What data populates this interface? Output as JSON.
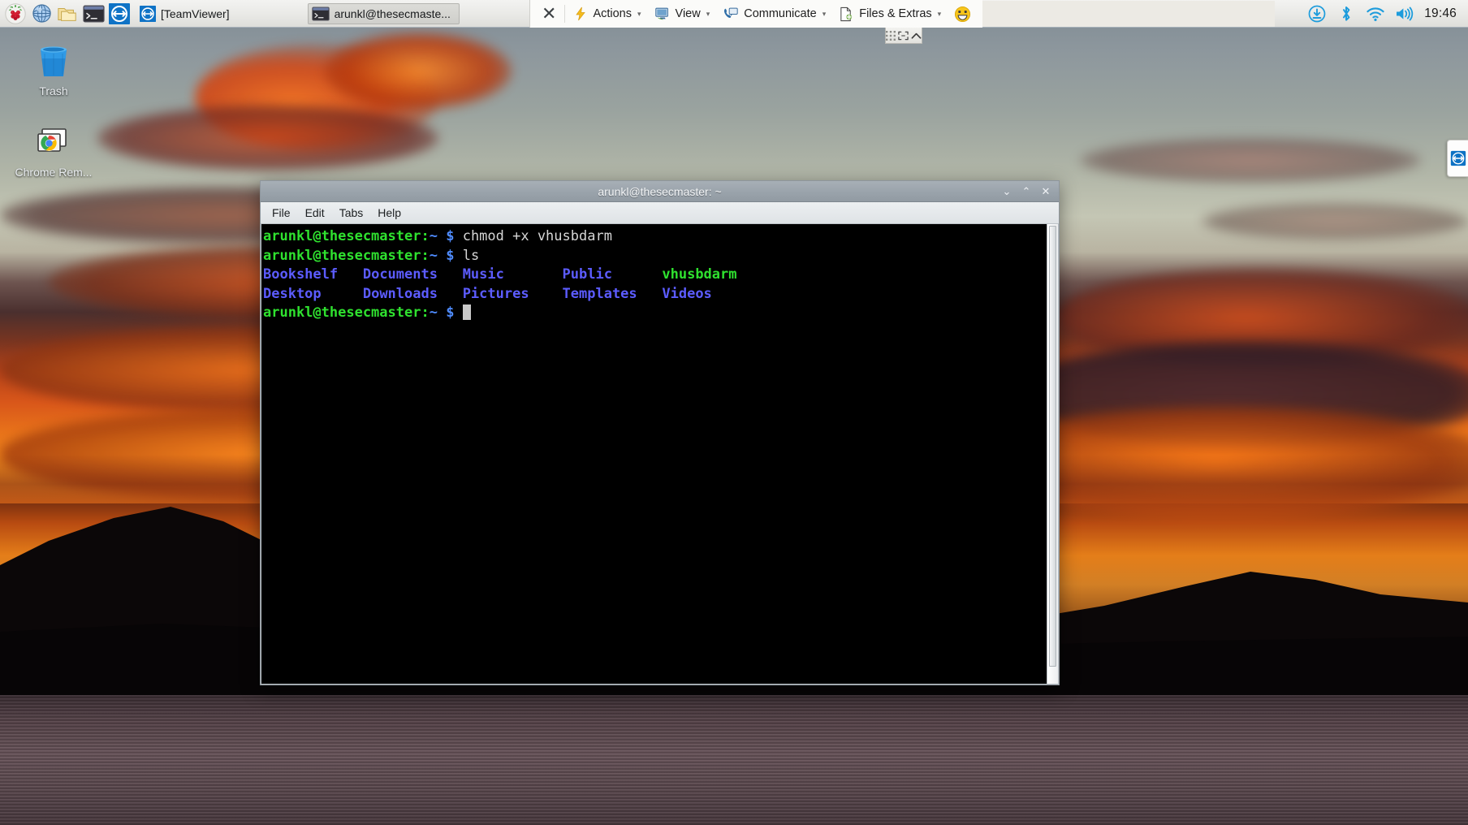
{
  "panel": {
    "launchers": [
      {
        "name": "raspberry-menu",
        "icon": "raspberry-icon",
        "label": "Menu"
      },
      {
        "name": "web-browser",
        "icon": "globe-icon",
        "label": "Web Browser"
      },
      {
        "name": "file-manager",
        "icon": "folder-icon",
        "label": "File Manager"
      },
      {
        "name": "terminal",
        "icon": "terminal-icon",
        "label": "Terminal"
      },
      {
        "name": "teamviewer",
        "icon": "teamviewer-icon",
        "label": "TeamViewer"
      }
    ],
    "windows": [
      {
        "title": "[TeamViewer]",
        "icon": "teamviewer-icon",
        "active": false
      },
      {
        "title": "arunkl@thesecmaste...",
        "icon": "terminal-icon",
        "active": true
      }
    ],
    "teamviewer_toolbar": {
      "close_label": "✕",
      "items": [
        {
          "label": "Actions",
          "icon": "lightning-icon",
          "caret": "▾"
        },
        {
          "label": "View",
          "icon": "monitor-icon",
          "caret": "▾"
        },
        {
          "label": "Communicate",
          "icon": "phone-icon",
          "caret": "▾"
        },
        {
          "label": "Files & Extras",
          "icon": "file-plus-icon",
          "caret": "▾"
        }
      ],
      "smiley": "ὠ0",
      "mini_controls": [
        {
          "name": "drag-grid-handle",
          "icon": "grid-handle-icon"
        },
        {
          "name": "fullscreen-toggle",
          "icon": "expand-icon"
        },
        {
          "name": "collapse-toolbar",
          "icon": "chevron-up-icon"
        }
      ]
    },
    "tray": [
      {
        "name": "updates",
        "icon": "download-arrow-icon"
      },
      {
        "name": "bluetooth",
        "icon": "bluetooth-icon"
      },
      {
        "name": "wifi",
        "icon": "wifi-icon"
      },
      {
        "name": "volume",
        "icon": "speaker-icon"
      }
    ],
    "clock": "19:46"
  },
  "desktop": {
    "icons": [
      {
        "name": "trash",
        "label": "Trash",
        "icon": "trash-icon"
      },
      {
        "name": "chrome-remote-desktop",
        "label": "Chrome Rem...",
        "icon": "chrome-remote-icon"
      }
    ],
    "teamviewer_edge_tab": {
      "name": "teamviewer-edge-tab",
      "icon": "teamviewer-icon"
    }
  },
  "terminal": {
    "title": "arunkl@thesecmaster: ~",
    "window_controls": {
      "minimize": "⌄",
      "maximize": "⌃",
      "close": "✕"
    },
    "menu": [
      "File",
      "Edit",
      "Tabs",
      "Help"
    ],
    "prompt": {
      "user_host": "arunkl@thesecmaster",
      "separator": ":",
      "path": "~",
      "sigil": "$"
    },
    "lines": [
      {
        "type": "prompt",
        "command": "chmod +x vhusbdarm"
      },
      {
        "type": "prompt",
        "command": "ls"
      },
      {
        "type": "ls",
        "cells": [
          {
            "text": "Bookshelf",
            "kind": "dir"
          },
          {
            "text": "Documents",
            "kind": "dir"
          },
          {
            "text": "Music",
            "kind": "dir"
          },
          {
            "text": "Public",
            "kind": "dir"
          },
          {
            "text": "vhusbdarm",
            "kind": "exec"
          }
        ]
      },
      {
        "type": "ls",
        "cells": [
          {
            "text": "Desktop",
            "kind": "dir"
          },
          {
            "text": "Downloads",
            "kind": "dir"
          },
          {
            "text": "Pictures",
            "kind": "dir"
          },
          {
            "text": "Templates",
            "kind": "dir"
          },
          {
            "text": "Videos",
            "kind": "dir"
          }
        ]
      },
      {
        "type": "prompt",
        "command": "",
        "cursor": true
      }
    ],
    "colors": {
      "background": "#000000",
      "prompt_user": "#2fe12f",
      "prompt_path": "#4f8cff",
      "directory": "#5c5cff",
      "executable": "#2fe12f",
      "command_text": "#d6d6d6"
    }
  }
}
